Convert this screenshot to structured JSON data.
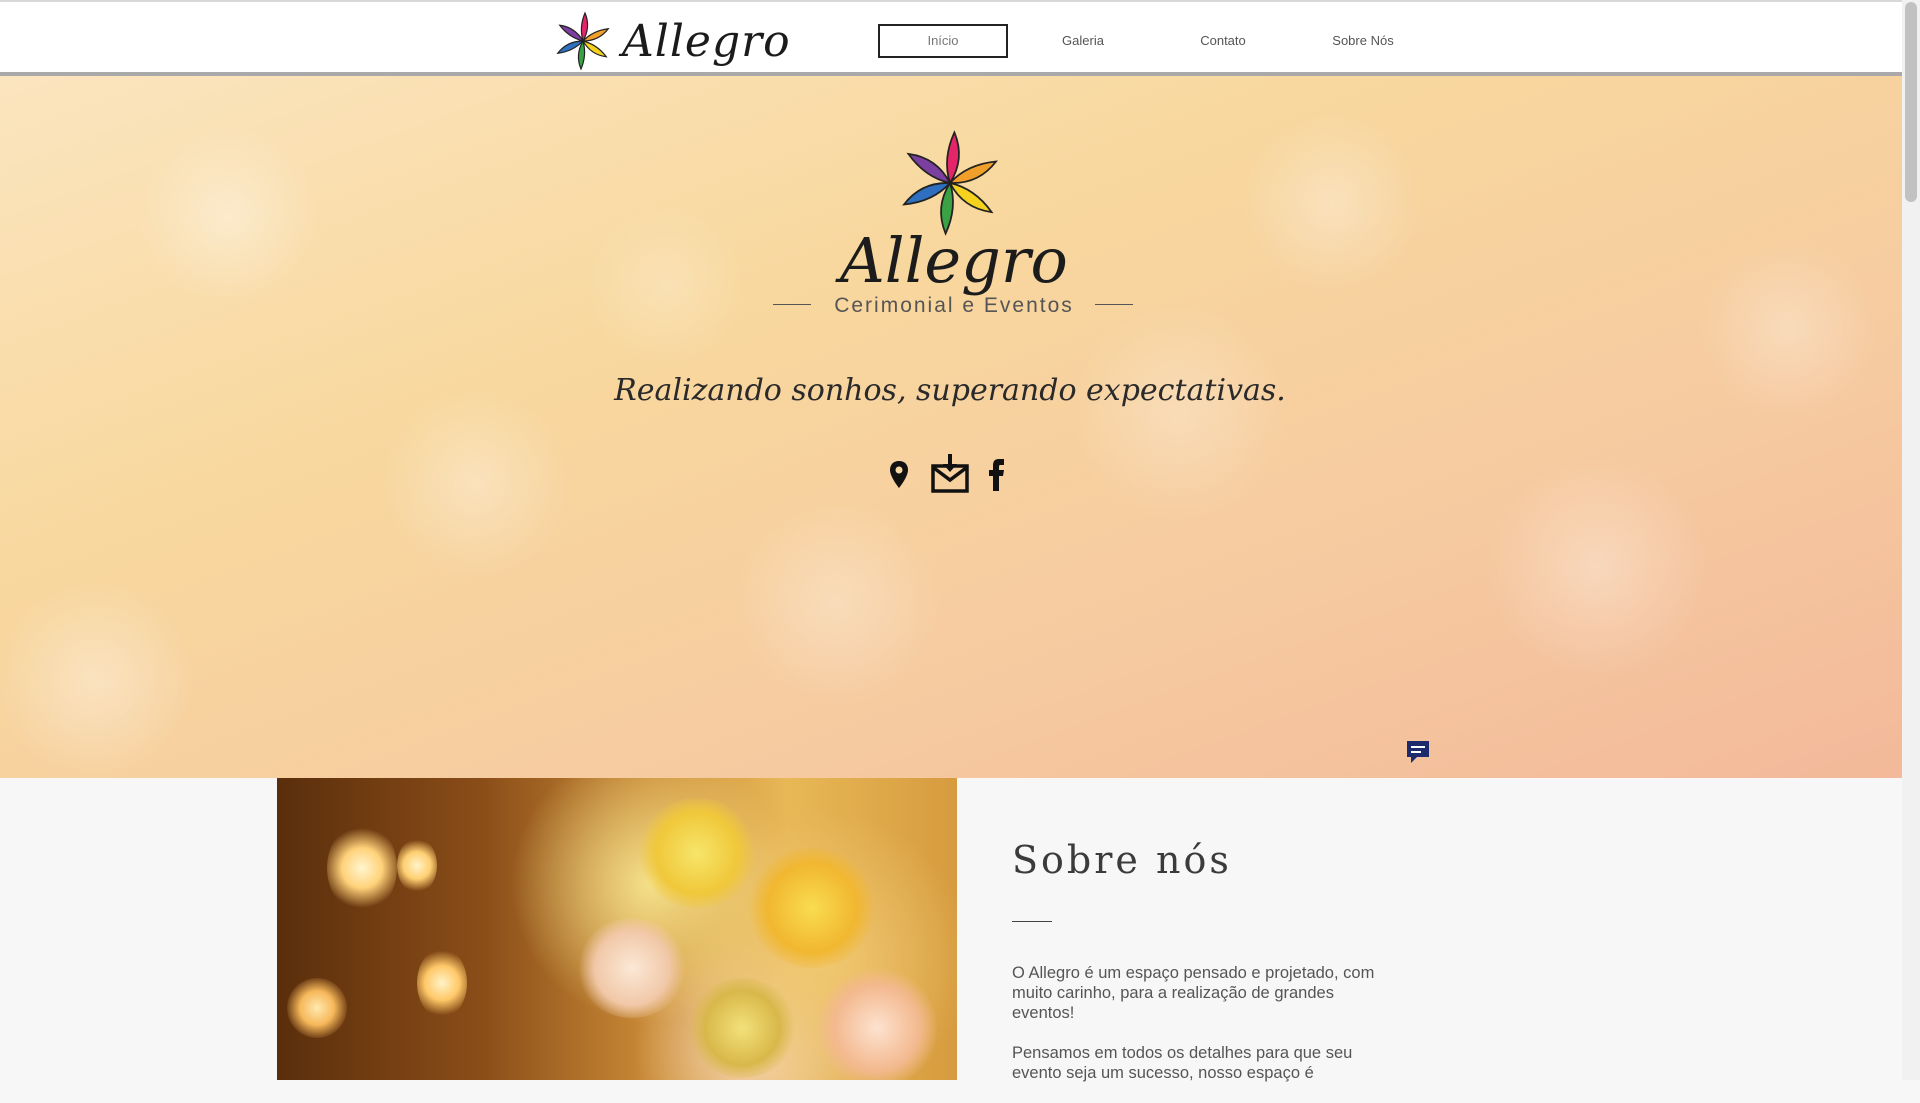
{
  "header": {
    "brand": "Allegro",
    "nav": [
      {
        "label": "Início",
        "active": true
      },
      {
        "label": "Galeria",
        "active": false
      },
      {
        "label": "Contato",
        "active": false
      },
      {
        "label": "Sobre Nós",
        "active": false
      }
    ]
  },
  "hero": {
    "brand": "Allegro",
    "tagline": "Cerimonial e Eventos",
    "slogan": "Realizando sonhos, superando expectativas.",
    "social_icons": [
      "map-pin-icon",
      "mail-icon",
      "facebook-icon"
    ],
    "chat_icon": "chat-icon"
  },
  "about": {
    "title": "Sobre nós",
    "paragraphs": [
      "O Allegro é um espaço pensado e projetado, com muito carinho, para a realização de grandes eventos!",
      "Pensamos em todos os detalhes para que seu evento seja um sucesso, nosso espaço é"
    ]
  },
  "colors": {
    "logo_petals": [
      "#e5256a",
      "#f0a02a",
      "#f4d21e",
      "#3aa244",
      "#2e6fc0",
      "#7b3fa0"
    ],
    "chat_icon": "#1e2a6e"
  }
}
